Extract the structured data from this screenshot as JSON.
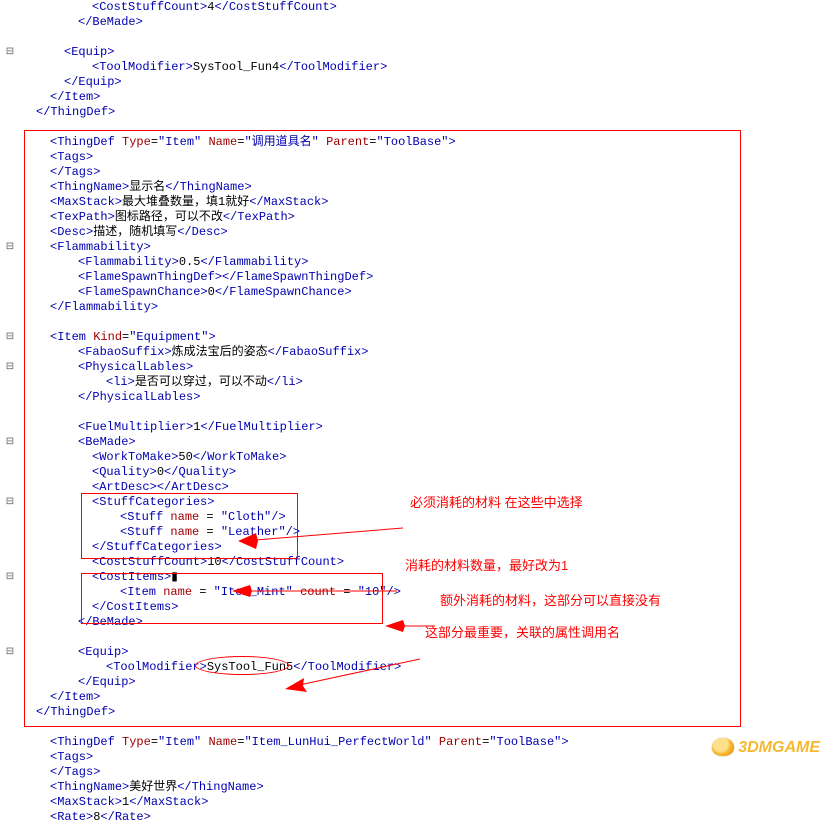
{
  "lines": [
    {
      "indent": 5,
      "segs": [
        [
          "br",
          "<"
        ],
        [
          "tag",
          "CostStuffCount"
        ],
        [
          "br",
          ">"
        ],
        [
          "txt",
          "4"
        ],
        [
          "br",
          "</"
        ],
        [
          "tag",
          "CostStuffCount"
        ],
        [
          "br",
          ">"
        ]
      ]
    },
    {
      "indent": 4,
      "segs": [
        [
          "br",
          "</"
        ],
        [
          "tag",
          "BeMade"
        ],
        [
          "br",
          ">"
        ]
      ]
    },
    {
      "indent": 0,
      "segs": []
    },
    {
      "indent": 3,
      "segs": [
        [
          "br",
          "<"
        ],
        [
          "tag",
          "Equip"
        ],
        [
          "br",
          ">"
        ]
      ]
    },
    {
      "indent": 5,
      "segs": [
        [
          "br",
          "<"
        ],
        [
          "tag",
          "ToolModifier"
        ],
        [
          "br",
          ">"
        ],
        [
          "txt",
          "SysTool_Fun4"
        ],
        [
          "br",
          "</"
        ],
        [
          "tag",
          "ToolModifier"
        ],
        [
          "br",
          ">"
        ]
      ]
    },
    {
      "indent": 3,
      "segs": [
        [
          "br",
          "</"
        ],
        [
          "tag",
          "Equip"
        ],
        [
          "br",
          ">"
        ]
      ]
    },
    {
      "indent": 2,
      "segs": [
        [
          "br",
          "</"
        ],
        [
          "tag",
          "Item"
        ],
        [
          "br",
          ">"
        ]
      ]
    },
    {
      "indent": 1,
      "segs": [
        [
          "br",
          "</"
        ],
        [
          "tag",
          "ThingDef"
        ],
        [
          "br",
          ">"
        ]
      ]
    },
    {
      "indent": 0,
      "segs": []
    },
    {
      "indent": 2,
      "segs": [
        [
          "br",
          "<"
        ],
        [
          "tag",
          "ThingDef "
        ],
        [
          "attr",
          "Type"
        ],
        [
          "eq",
          "="
        ],
        [
          "tag",
          "\"Item\" "
        ],
        [
          "attr",
          "Name"
        ],
        [
          "eq",
          "="
        ],
        [
          "tag",
          "\"调用道具名\" "
        ],
        [
          "attr",
          "Parent"
        ],
        [
          "eq",
          "="
        ],
        [
          "tag",
          "\"ToolBase\""
        ],
        [
          "br",
          ">"
        ]
      ]
    },
    {
      "indent": 2,
      "segs": [
        [
          "br",
          "<"
        ],
        [
          "tag",
          "Tags"
        ],
        [
          "br",
          ">"
        ]
      ]
    },
    {
      "indent": 2,
      "segs": [
        [
          "br",
          "</"
        ],
        [
          "tag",
          "Tags"
        ],
        [
          "br",
          ">"
        ]
      ]
    },
    {
      "indent": 2,
      "segs": [
        [
          "br",
          "<"
        ],
        [
          "tag",
          "ThingName"
        ],
        [
          "br",
          ">"
        ],
        [
          "txt",
          "显示名"
        ],
        [
          "br",
          "</"
        ],
        [
          "tag",
          "ThingName"
        ],
        [
          "br",
          ">"
        ]
      ]
    },
    {
      "indent": 2,
      "segs": [
        [
          "br",
          "<"
        ],
        [
          "tag",
          "MaxStack"
        ],
        [
          "br",
          ">"
        ],
        [
          "txt",
          "最大堆叠数量，填1就好"
        ],
        [
          "br",
          "</"
        ],
        [
          "tag",
          "MaxStack"
        ],
        [
          "br",
          ">"
        ]
      ]
    },
    {
      "indent": 2,
      "segs": [
        [
          "br",
          "<"
        ],
        [
          "tag",
          "TexPath"
        ],
        [
          "br",
          ">"
        ],
        [
          "txt",
          "图标路径，可以不改"
        ],
        [
          "br",
          "</"
        ],
        [
          "tag",
          "TexPath"
        ],
        [
          "br",
          ">"
        ]
      ]
    },
    {
      "indent": 2,
      "segs": [
        [
          "br",
          "<"
        ],
        [
          "tag",
          "Desc"
        ],
        [
          "br",
          ">"
        ],
        [
          "txt",
          "描述，随机填写"
        ],
        [
          "br",
          "</"
        ],
        [
          "tag",
          "Desc"
        ],
        [
          "br",
          ">"
        ]
      ]
    },
    {
      "indent": 2,
      "segs": [
        [
          "br",
          "<"
        ],
        [
          "tag",
          "Flammability"
        ],
        [
          "br",
          ">"
        ]
      ]
    },
    {
      "indent": 4,
      "segs": [
        [
          "br",
          "<"
        ],
        [
          "tag",
          "Flammability"
        ],
        [
          "br",
          ">"
        ],
        [
          "txt",
          "0.5"
        ],
        [
          "br",
          "</"
        ],
        [
          "tag",
          "Flammability"
        ],
        [
          "br",
          ">"
        ]
      ]
    },
    {
      "indent": 4,
      "segs": [
        [
          "br",
          "<"
        ],
        [
          "tag",
          "FlameSpawnThingDef"
        ],
        [
          "br",
          ">"
        ],
        [
          "br",
          "</"
        ],
        [
          "tag",
          "FlameSpawnThingDef"
        ],
        [
          "br",
          ">"
        ]
      ]
    },
    {
      "indent": 4,
      "segs": [
        [
          "br",
          "<"
        ],
        [
          "tag",
          "FlameSpawnChance"
        ],
        [
          "br",
          ">"
        ],
        [
          "txt",
          "0"
        ],
        [
          "br",
          "</"
        ],
        [
          "tag",
          "FlameSpawnChance"
        ],
        [
          "br",
          ">"
        ]
      ]
    },
    {
      "indent": 2,
      "segs": [
        [
          "br",
          "</"
        ],
        [
          "tag",
          "Flammability"
        ],
        [
          "br",
          ">"
        ]
      ]
    },
    {
      "indent": 0,
      "segs": []
    },
    {
      "indent": 2,
      "segs": [
        [
          "br",
          "<"
        ],
        [
          "tag",
          "Item "
        ],
        [
          "attr",
          "Kind"
        ],
        [
          "eq",
          "="
        ],
        [
          "tag",
          "\"Equipment\""
        ],
        [
          "br",
          ">"
        ]
      ]
    },
    {
      "indent": 4,
      "segs": [
        [
          "br",
          "<"
        ],
        [
          "tag",
          "FabaoSuffix"
        ],
        [
          "br",
          ">"
        ],
        [
          "txt",
          "炼成法宝后的姿态"
        ],
        [
          "br",
          "</"
        ],
        [
          "tag",
          "FabaoSuffix"
        ],
        [
          "br",
          ">"
        ]
      ]
    },
    {
      "indent": 4,
      "segs": [
        [
          "br",
          "<"
        ],
        [
          "tag",
          "PhysicalLables"
        ],
        [
          "br",
          ">"
        ]
      ]
    },
    {
      "indent": 6,
      "segs": [
        [
          "br",
          "<"
        ],
        [
          "tag",
          "li"
        ],
        [
          "br",
          ">"
        ],
        [
          "txt",
          "是否可以穿过，可以不动"
        ],
        [
          "br",
          "</"
        ],
        [
          "tag",
          "li"
        ],
        [
          "br",
          ">"
        ]
      ]
    },
    {
      "indent": 4,
      "segs": [
        [
          "br",
          "</"
        ],
        [
          "tag",
          "PhysicalLables"
        ],
        [
          "br",
          ">"
        ]
      ]
    },
    {
      "indent": 0,
      "segs": []
    },
    {
      "indent": 4,
      "segs": [
        [
          "br",
          "<"
        ],
        [
          "tag",
          "FuelMultiplier"
        ],
        [
          "br",
          ">"
        ],
        [
          "txt",
          "1"
        ],
        [
          "br",
          "</"
        ],
        [
          "tag",
          "FuelMultiplier"
        ],
        [
          "br",
          ">"
        ]
      ]
    },
    {
      "indent": 4,
      "segs": [
        [
          "br",
          "<"
        ],
        [
          "tag",
          "BeMade"
        ],
        [
          "br",
          ">"
        ]
      ]
    },
    {
      "indent": 5,
      "segs": [
        [
          "br",
          "<"
        ],
        [
          "tag",
          "WorkToMake"
        ],
        [
          "br",
          ">"
        ],
        [
          "txt",
          "50"
        ],
        [
          "br",
          "</"
        ],
        [
          "tag",
          "WorkToMake"
        ],
        [
          "br",
          ">"
        ]
      ]
    },
    {
      "indent": 5,
      "segs": [
        [
          "br",
          "<"
        ],
        [
          "tag",
          "Quality"
        ],
        [
          "br",
          ">"
        ],
        [
          "txt",
          "0"
        ],
        [
          "br",
          "</"
        ],
        [
          "tag",
          "Quality"
        ],
        [
          "br",
          ">"
        ]
      ]
    },
    {
      "indent": 5,
      "segs": [
        [
          "br",
          "<"
        ],
        [
          "tag",
          "ArtDesc"
        ],
        [
          "br",
          ">"
        ],
        [
          "br",
          "</"
        ],
        [
          "tag",
          "ArtDesc"
        ],
        [
          "br",
          ">"
        ]
      ]
    },
    {
      "indent": 5,
      "segs": [
        [
          "br",
          "<"
        ],
        [
          "tag",
          "StuffCategories"
        ],
        [
          "br",
          ">"
        ]
      ]
    },
    {
      "indent": 7,
      "segs": [
        [
          "br",
          "<"
        ],
        [
          "tag",
          "Stuff "
        ],
        [
          "attr",
          "name"
        ],
        [
          "eq",
          " = "
        ],
        [
          "tag",
          "\"Cloth\""
        ],
        [
          "br",
          "/>"
        ]
      ]
    },
    {
      "indent": 7,
      "segs": [
        [
          "br",
          "<"
        ],
        [
          "tag",
          "Stuff "
        ],
        [
          "attr",
          "name"
        ],
        [
          "eq",
          " = "
        ],
        [
          "tag",
          "\"Leather\""
        ],
        [
          "br",
          "/>"
        ]
      ]
    },
    {
      "indent": 5,
      "segs": [
        [
          "br",
          "</"
        ],
        [
          "tag",
          "StuffCategories"
        ],
        [
          "br",
          ">"
        ]
      ]
    },
    {
      "indent": 5,
      "segs": [
        [
          "br",
          "<"
        ],
        [
          "tag",
          "CostStuffCount"
        ],
        [
          "br",
          ">"
        ],
        [
          "txt",
          "10"
        ],
        [
          "br",
          "</"
        ],
        [
          "tag",
          "CostStuffCount"
        ],
        [
          "br",
          ">"
        ]
      ]
    },
    {
      "indent": 5,
      "segs": [
        [
          "br",
          "<"
        ],
        [
          "tag",
          "CostItems"
        ],
        [
          "br",
          ">"
        ],
        [
          "txt",
          "▮"
        ]
      ]
    },
    {
      "indent": 7,
      "segs": [
        [
          "br",
          "<"
        ],
        [
          "tag",
          "Item "
        ],
        [
          "attr",
          "name"
        ],
        [
          "eq",
          " = "
        ],
        [
          "tag",
          "\"Item_Mint\" "
        ],
        [
          "attr",
          "count"
        ],
        [
          "eq",
          " = "
        ],
        [
          "tag",
          "\"10\""
        ],
        [
          "br",
          "/>"
        ]
      ]
    },
    {
      "indent": 5,
      "segs": [
        [
          "br",
          "</"
        ],
        [
          "tag",
          "CostItems"
        ],
        [
          "br",
          ">"
        ]
      ]
    },
    {
      "indent": 4,
      "segs": [
        [
          "br",
          "</"
        ],
        [
          "tag",
          "BeMade"
        ],
        [
          "br",
          ">"
        ]
      ]
    },
    {
      "indent": 0,
      "segs": []
    },
    {
      "indent": 4,
      "segs": [
        [
          "br",
          "<"
        ],
        [
          "tag",
          "Equip"
        ],
        [
          "br",
          ">"
        ]
      ]
    },
    {
      "indent": 6,
      "segs": [
        [
          "br",
          "<"
        ],
        [
          "tag",
          "ToolModifier"
        ],
        [
          "br",
          ">"
        ],
        [
          "txt",
          "SysTool_Fun5"
        ],
        [
          "br",
          "</"
        ],
        [
          "tag",
          "ToolModifier"
        ],
        [
          "br",
          ">"
        ]
      ]
    },
    {
      "indent": 4,
      "segs": [
        [
          "br",
          "</"
        ],
        [
          "tag",
          "Equip"
        ],
        [
          "br",
          ">"
        ]
      ]
    },
    {
      "indent": 2,
      "segs": [
        [
          "br",
          "</"
        ],
        [
          "tag",
          "Item"
        ],
        [
          "br",
          ">"
        ]
      ]
    },
    {
      "indent": 1,
      "segs": [
        [
          "br",
          "</"
        ],
        [
          "tag",
          "ThingDef"
        ],
        [
          "br",
          ">"
        ]
      ]
    },
    {
      "indent": 0,
      "segs": []
    },
    {
      "indent": 2,
      "segs": [
        [
          "br",
          "<"
        ],
        [
          "tag",
          "ThingDef "
        ],
        [
          "attr",
          "Type"
        ],
        [
          "eq",
          "="
        ],
        [
          "tag",
          "\"Item\" "
        ],
        [
          "attr",
          "Name"
        ],
        [
          "eq",
          "="
        ],
        [
          "tag",
          "\"Item_LunHui_PerfectWorld\" "
        ],
        [
          "attr",
          "Parent"
        ],
        [
          "eq",
          "="
        ],
        [
          "tag",
          "\"ToolBase\""
        ],
        [
          "br",
          ">"
        ]
      ]
    },
    {
      "indent": 2,
      "segs": [
        [
          "br",
          "<"
        ],
        [
          "tag",
          "Tags"
        ],
        [
          "br",
          ">"
        ]
      ]
    },
    {
      "indent": 2,
      "segs": [
        [
          "br",
          "</"
        ],
        [
          "tag",
          "Tags"
        ],
        [
          "br",
          ">"
        ]
      ]
    },
    {
      "indent": 2,
      "segs": [
        [
          "br",
          "<"
        ],
        [
          "tag",
          "ThingName"
        ],
        [
          "br",
          ">"
        ],
        [
          "txt",
          "美好世界"
        ],
        [
          "br",
          "</"
        ],
        [
          "tag",
          "ThingName"
        ],
        [
          "br",
          ">"
        ]
      ]
    },
    {
      "indent": 2,
      "segs": [
        [
          "br",
          "<"
        ],
        [
          "tag",
          "MaxStack"
        ],
        [
          "br",
          ">"
        ],
        [
          "txt",
          "1"
        ],
        [
          "br",
          "</"
        ],
        [
          "tag",
          "MaxStack"
        ],
        [
          "br",
          ">"
        ]
      ]
    },
    {
      "indent": 2,
      "segs": [
        [
          "br",
          "<"
        ],
        [
          "tag",
          "Rate"
        ],
        [
          "br",
          ">"
        ],
        [
          "txt",
          "8"
        ],
        [
          "br",
          "</"
        ],
        [
          "tag",
          "Rate"
        ],
        [
          "br",
          ">"
        ]
      ]
    }
  ],
  "folds": [
    3,
    16,
    22,
    24,
    29,
    33,
    38,
    43
  ],
  "annotations": {
    "a1": "必须消耗的材料 在这些中选择",
    "a2": "消耗的材料数量，最好改为1",
    "a3": "额外消耗的材料，这部分可以直接没有",
    "a4": "这部分最重要，关联的属性调用名"
  },
  "watermark": "3DMGAME"
}
